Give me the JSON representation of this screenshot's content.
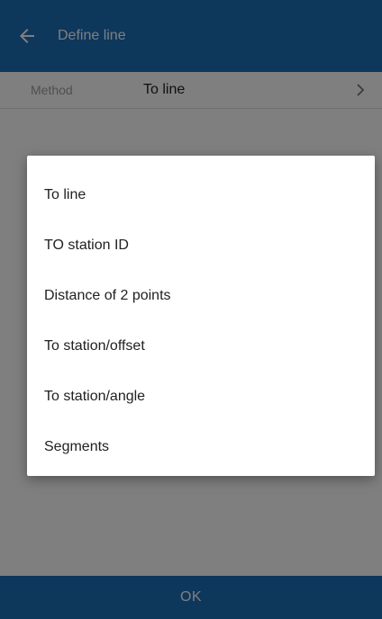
{
  "colors": {
    "primary": "#1c6fb8",
    "on_primary": "#ffffff",
    "scrim": "rgba(0,0,0,0.5)"
  },
  "appbar": {
    "back_icon": "arrow-left-icon",
    "title": "Define line"
  },
  "method": {
    "label": "Method",
    "value": "To line",
    "chevron_icon": "chevron-right-icon"
  },
  "footer": {
    "ok_label": "OK"
  },
  "dialog": {
    "options": [
      {
        "label": "To line"
      },
      {
        "label": "TO station ID"
      },
      {
        "label": "Distance of 2 points"
      },
      {
        "label": "To station/offset"
      },
      {
        "label": "To station/angle"
      },
      {
        "label": "Segments"
      }
    ]
  }
}
